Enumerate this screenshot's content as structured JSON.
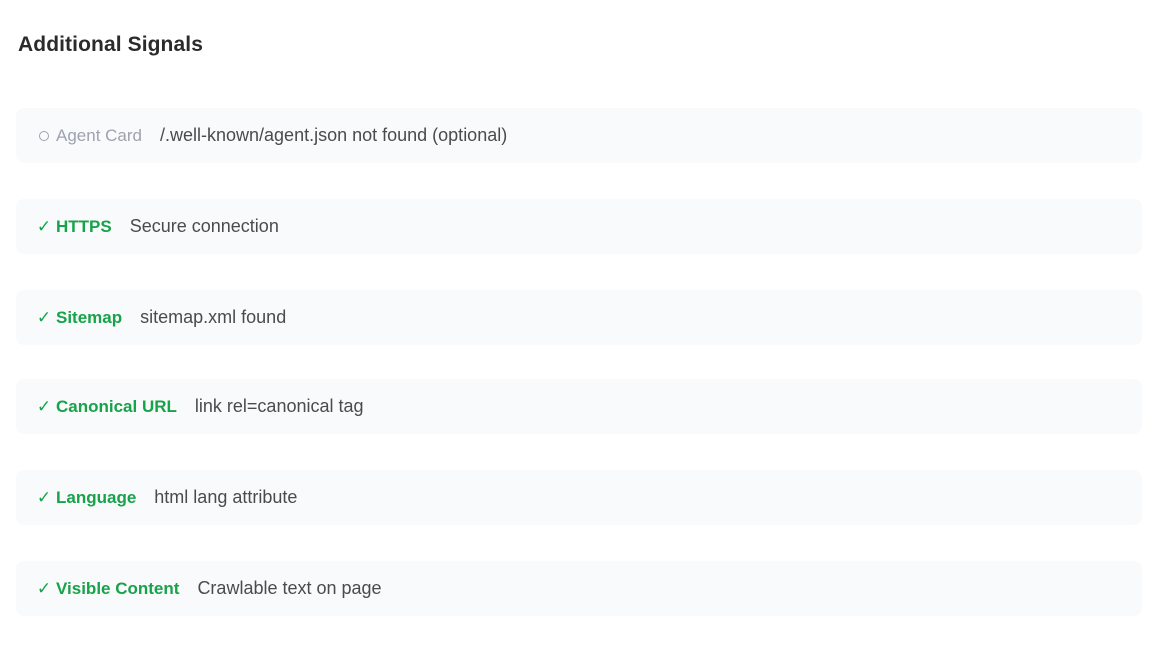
{
  "section": {
    "title": "Additional Signals"
  },
  "signals": [
    {
      "status": "optional",
      "icon": "circle-outline-icon",
      "name": "Agent Card",
      "description": "/.well-known/agent.json not found (optional)"
    },
    {
      "status": "pass",
      "icon": "check-icon",
      "name": "HTTPS",
      "description": "Secure connection"
    },
    {
      "status": "pass",
      "icon": "check-icon",
      "name": "Sitemap",
      "description": "sitemap.xml found"
    },
    {
      "status": "pass",
      "icon": "check-icon",
      "name": "Canonical URL",
      "description": "link rel=canonical tag"
    },
    {
      "status": "pass",
      "icon": "check-icon",
      "name": "Language",
      "description": "html lang attribute"
    },
    {
      "status": "pass",
      "icon": "check-icon",
      "name": "Visible Content",
      "description": "Crawlable text on page"
    }
  ],
  "colors": {
    "pass": "#16a34a",
    "optional": "#9ca3af",
    "row_background": "#f9fafb"
  }
}
